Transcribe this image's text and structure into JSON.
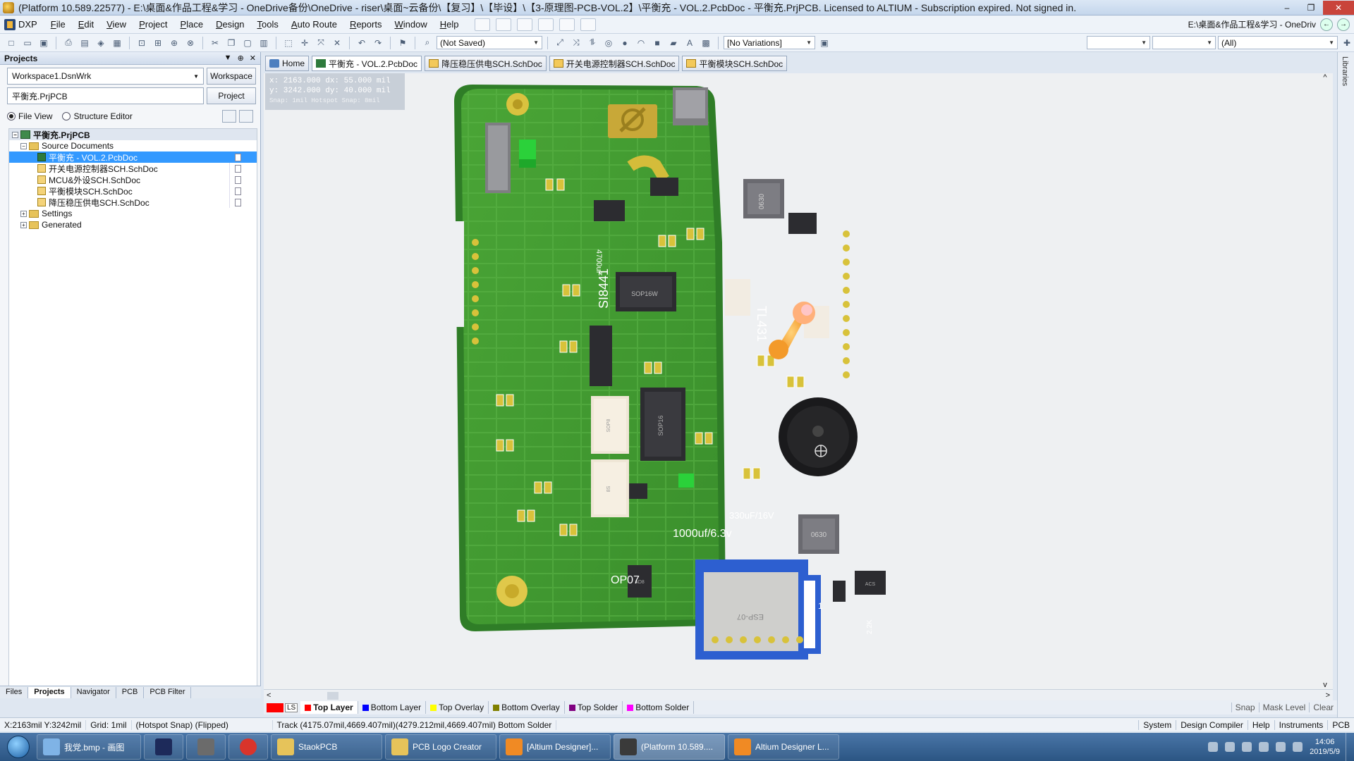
{
  "title_bar": {
    "text": "(Platform 10.589.22577) - E:\\桌面&作品工程&学习 - OneDrive备份\\OneDrive - riser\\桌面~云备份\\【复习】\\【毕设】\\【3-原理图-PCB-VOL.2】\\平衡充 - VOL.2.PcbDoc - 平衡充.PrjPCB. Licensed to ALTIUM - Subscription expired. Not signed in.",
    "minimize": "–",
    "restore": "❐",
    "close": "✕"
  },
  "menu": {
    "dxp": "DXP",
    "items": [
      "File",
      "Edit",
      "View",
      "Project",
      "Place",
      "Design",
      "Tools",
      "Auto Route",
      "Reports",
      "Window",
      "Help"
    ],
    "path_text": "E:\\桌面&作品工程&学习 - OneDriv",
    "back": "←",
    "forward": "→"
  },
  "toolbar": {
    "save_state": "(Not Saved)",
    "variations": "[No Variations]",
    "filter_all": "(All)"
  },
  "panel": {
    "title": "Projects",
    "ctrl_menu": "▼",
    "ctrl_pin": "⊕",
    "ctrl_close": "✕",
    "workspace_field": "Workspace1.DsnWrk",
    "workspace_button": "Workspace",
    "project_field": "平衡充.PrjPCB",
    "project_button": "Project",
    "view_file": "File View",
    "view_structure": "Structure Editor",
    "tree": {
      "project": "平衡充.PrjPCB",
      "source_documents": "Source Documents",
      "documents": [
        "平衡充 - VOL.2.PcbDoc",
        "开关电源控制器SCH.SchDoc",
        "MCU&外设SCH.SchDoc",
        "平衡模块SCH.SchDoc",
        "降压稳压供电SCH.SchDoc"
      ],
      "settings": "Settings",
      "generated": "Generated"
    },
    "tabs": [
      "Files",
      "Projects",
      "Navigator",
      "PCB",
      "PCB Filter"
    ]
  },
  "doc_tabs": [
    "Home",
    "平衡充 - VOL.2.PcbDoc",
    "降压稳压供电SCH.SchDoc",
    "开关电源控制器SCH.SchDoc",
    "平衡模块SCH.SchDoc"
  ],
  "libraries_label": "Libraries",
  "coord_overlay": {
    "line1": "x: 2163.000   dx: 55.000 mil",
    "line2": "y: 3242.000   dy: 40.000 mil",
    "line3": "Snap: 1mil  Hotspot Snap: 8mil"
  },
  "pcb_labels": {
    "si8441": "SI8441",
    "tl431": "TL431",
    "op07": "OP07",
    "cap_1000": "1000uf/6.3v",
    "cap_330": "330uF/16V",
    "esp": "ESP-07",
    "ind1": "0630",
    "ind2": "0630",
    "cap_4700": "4700uF",
    "ic_marks": [
      "SOP16W",
      "SOP16",
      "AD8",
      "SOP8",
      "ACS",
      "8S"
    ],
    "antenna_note": "1",
    "side_mark": "2.2K"
  },
  "scroll": {
    "left": "<",
    "right": ">",
    "up": "^",
    "down": "v"
  },
  "layers": {
    "ls": "LS",
    "tabs": [
      {
        "name": "Top Layer",
        "color": "#ff0000"
      },
      {
        "name": "Bottom Layer",
        "color": "#0000ff"
      },
      {
        "name": "Top Overlay",
        "color": "#ffff00"
      },
      {
        "name": "Bottom Overlay",
        "color": "#808000"
      },
      {
        "name": "Top Solder",
        "color": "#800080"
      },
      {
        "name": "Bottom Solder",
        "color": "#ff00ff"
      }
    ],
    "tail": [
      "Snap",
      "Mask Level",
      "Clear"
    ]
  },
  "status": {
    "coords": "X:2163mil Y:3242mil",
    "grid": "Grid: 1mil",
    "snap": "(Hotspot Snap) (Flipped)",
    "track": "Track (4175.07mil,4669.407mil)(4279.212mil,4669.407mil)  Bottom Solder",
    "right": [
      "System",
      "Design Compiler",
      "Help",
      "Instruments",
      "PCB"
    ]
  },
  "taskbar": {
    "apps": [
      {
        "label": "我党.bmp - 画图",
        "color": "#7fb3e6"
      },
      {
        "label": "",
        "color": "#1d2a5a"
      },
      {
        "label": "",
        "color": "#6b6b6b"
      },
      {
        "label": "",
        "color": "#d9342b"
      },
      {
        "label": "StaokPCB",
        "color": "#e6c35a"
      },
      {
        "label": "PCB Logo Creator",
        "color": "#e6c35a"
      },
      {
        "label": "[Altium Designer]...",
        "color": "#f08a24"
      },
      {
        "label": "(Platform 10.589....",
        "color": "#3a3a3a"
      },
      {
        "label": "Altium Designer L...",
        "color": "#f08a24"
      }
    ],
    "time": "14:06",
    "date": "2019/5/9"
  },
  "colors": {
    "board_green": "#3e9a2e",
    "board_edge": "#2f7d27",
    "pad_gold": "#d8c23a",
    "silk_white": "#ffffff",
    "selection_blue": "#3399ff"
  }
}
